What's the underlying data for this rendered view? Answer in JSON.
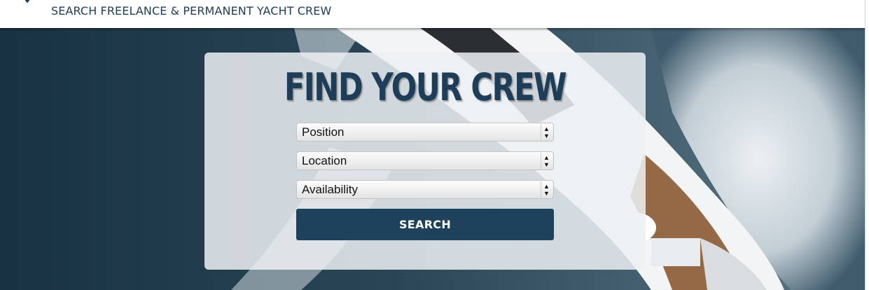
{
  "header": {
    "tagline": "SEARCH FREELANCE & PERMANENT YACHT CREW"
  },
  "search": {
    "title": "FIND YOUR CREW",
    "position_selected": "Position",
    "location_selected": "Location",
    "availability_selected": "Availability",
    "button_label": "SEARCH"
  },
  "colors": {
    "brand_navy": "#1e425c",
    "background_dark": "#1b3443"
  }
}
